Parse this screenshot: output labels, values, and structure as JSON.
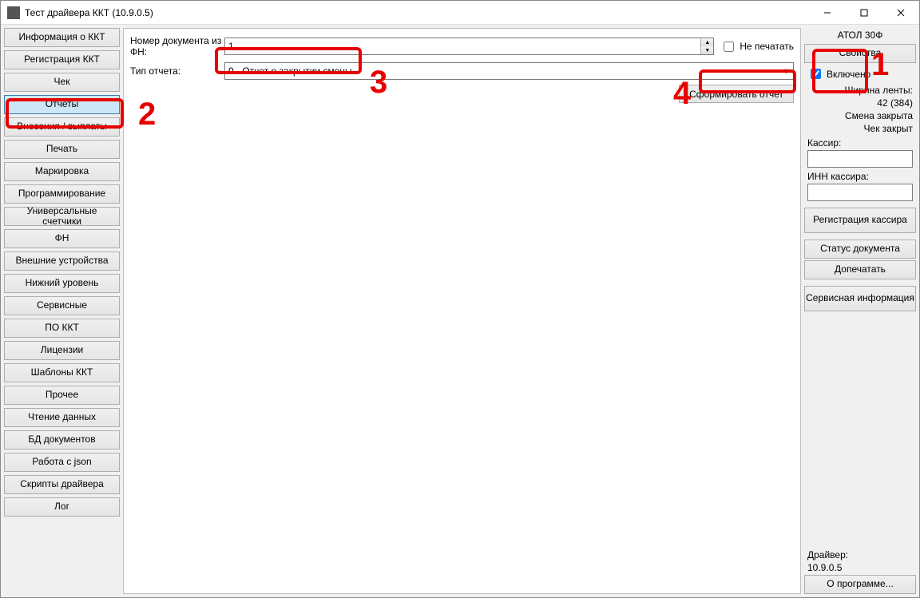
{
  "window": {
    "title": "Тест драйвера ККТ (10.9.0.5)"
  },
  "sidebar": {
    "items": [
      "Информация о ККТ",
      "Регистрация ККТ",
      "Чек",
      "Отчеты",
      "Внесения / выплаты",
      "Печать",
      "Маркировка",
      "Программирование",
      "Универсальные счетчики",
      "ФН",
      "Внешние устройства",
      "Нижний уровень",
      "Сервисные",
      "ПО ККТ",
      "Лицензии",
      "Шаблоны ККТ",
      "Прочее",
      "Чтение данных",
      "БД документов",
      "Работа с json",
      "Скрипты драйвера",
      "Лог"
    ],
    "active_index": 3
  },
  "main": {
    "doc_number_label": "Номер документа из ФН:",
    "doc_number_value": "1",
    "no_print_label": "Не печатать",
    "no_print_checked": false,
    "report_type_label": "Тип отчета:",
    "report_type_value": "0 - Отчет о закрытии смены",
    "generate_button": "Сформировать отчет"
  },
  "right": {
    "device_name": "АТОЛ 30Ф",
    "properties_button": "Свойства",
    "enabled_label": "Включено",
    "enabled_checked": true,
    "tape_width_label": "Ширина ленты:",
    "tape_width_value": "42 (384)",
    "shift_status": "Смена закрыта",
    "cheque_status": "Чек закрыт",
    "cashier_label": "Кассир:",
    "inn_label": "ИНН кассира:",
    "register_cashier_button": "Регистрация кассира",
    "doc_status_button": "Статус документа",
    "reprint_button": "Допечатать",
    "service_info_button": "Сервисная информация",
    "driver_label": "Драйвер:",
    "driver_version": "10.9.0.5",
    "about_button": "О программе..."
  },
  "annotations": {
    "n1": "1",
    "n2": "2",
    "n3": "3",
    "n4": "4"
  }
}
